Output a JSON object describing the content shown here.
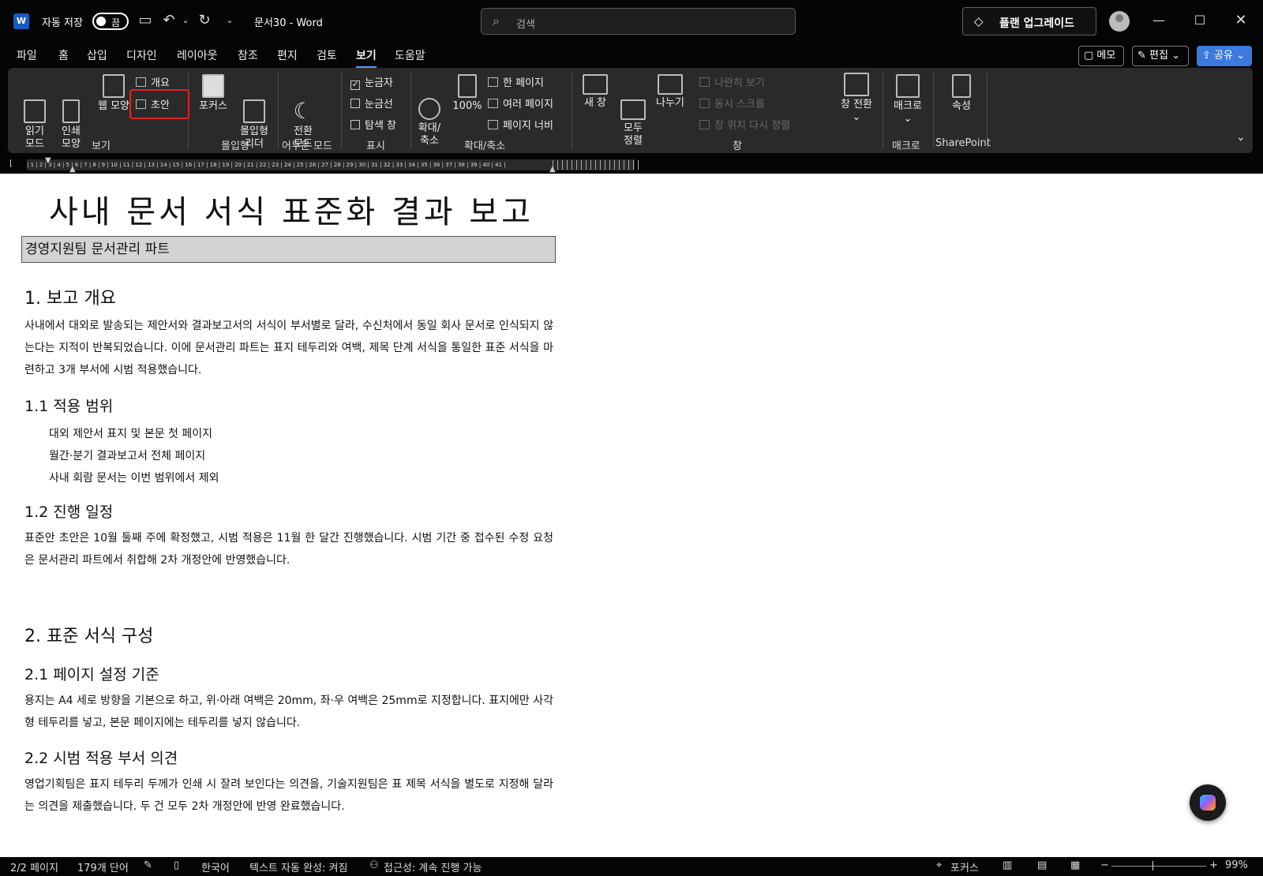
{
  "titlebar": {
    "app_logo": "W",
    "autosave_label": "자동 저장",
    "autosave_state": "끔",
    "document_title": "문서30  -  Word",
    "search_placeholder": "검색",
    "upgrade_label": "플랜 업그레이드"
  },
  "menu": {
    "items": [
      "파일",
      "홈",
      "삽입",
      "디자인",
      "레이아웃",
      "참조",
      "편지",
      "검토",
      "보기",
      "도움말"
    ],
    "active": "보기",
    "memo_label": "메모",
    "edit_label": "편집",
    "share_label": "공유"
  },
  "ribbon": {
    "views": {
      "read_mode": "읽기\n모드",
      "print_layout": "인쇄\n모양",
      "web_layout": "웹 모양",
      "outline": "개요",
      "draft": "초안",
      "group_label": "보기"
    },
    "immersive": {
      "focus": "포커스",
      "immersive_reader": "몰입형\n리더",
      "group_label": "몰입형"
    },
    "dark_mode": {
      "switch_mode": "전환\n모드",
      "group_label": "어두운 모드"
    },
    "show": {
      "ruler": "눈금자",
      "gridlines": "눈금선",
      "navigation_pane": "탐색 창",
      "group_label": "표시"
    },
    "zoom": {
      "zoom": "확대/\n축소",
      "hundred": "100%",
      "one_page": "한 페이지",
      "multiple_pages": "여러 페이지",
      "page_width": "페이지 너비",
      "group_label": "확대/축소"
    },
    "window": {
      "new_window": "새 창",
      "arrange_all": "모두\n정렬",
      "split": "나누기",
      "side_by_side": "나란히 보기",
      "sync_scroll": "동시 스크롤",
      "reset_position": "창 위치 다시 정렬",
      "switch_windows": "창 전환",
      "group_label": "창"
    },
    "macros": {
      "macros": "매크로",
      "group_label": "매크로"
    },
    "sharepoint": {
      "properties": "속성",
      "group_label": "SharePoint"
    }
  },
  "document": {
    "title": "사내 문서 서식 표준화 결과 보고",
    "subtitle": "경영지원팀 문서관리 파트",
    "s1_heading": "1. 보고 개요",
    "s1_para": "사내에서 대외로 발송되는 제안서와 결과보고서의 서식이 부서별로 달라, 수신처에서 동일 회사 문서로 인식되지 않는다는 지적이 반복되었습니다. 이에 문서관리 파트는 표지 테두리와 여백, 제목 단계 서식을 통일한 표준 서식을 마련하고 3개 부서에 시범 적용했습니다.",
    "s1_1_heading": "1.1  적용 범위",
    "s1_1_items": [
      "대외 제안서 표지 및 본문 첫 페이지",
      "월간·분기 결과보고서 전체 페이지",
      "사내 회람 문서는 이번 범위에서 제외"
    ],
    "s1_2_heading": "1.2  진행 일정",
    "s1_2_para": "표준안 초안은 10월 둘째 주에 확정했고, 시범 적용은 11월 한 달간 진행했습니다. 시범 기간 중 접수된 수정 요청은 문서관리 파트에서 취합해 2차 개정안에 반영했습니다.",
    "s2_heading": "2. 표준 서식 구성",
    "s2_1_heading": "2.1  페이지 설정 기준",
    "s2_1_para": "용지는 A4 세로 방향을 기본으로 하고, 위·아래 여백은 20mm, 좌·우 여백은 25mm로 지정합니다. 표지에만 사각형 테두리를 넣고, 본문 페이지에는 테두리를 넣지 않습니다.",
    "s2_2_heading": "2.2  시범 적용 부서 의견",
    "s2_2_para": "영업기획팀은 표지 테두리 두께가 인쇄 시 잘려 보인다는 의견을, 기술지원팀은 표 제목 서식을 별도로 지정해 달라는 의견을 제출했습니다. 두 건 모두 2차 개정안에 반영 완료했습니다."
  },
  "ruler": {
    "numbers": "| 1 | 2 | 3 | 4 | 5 | 6 | 7 | 8 | 9 | 10 | 11 | 12 | 13 | 14 | 15 | 16 | 17 | 18 | 19 | 20 | 21 | 22 | 23 | 24 | 25 | 26 | 27 | 28 | 29 | 30 | 31 | 32 | 33 | 34 | 35 | 36 | 37 | 38 | 39 | 40 | 41 |"
  },
  "statusbar": {
    "page": "2/2 페이지",
    "words": "179개 단어",
    "language": "한국어",
    "autocomplete": "텍스트 자동 완성: 켜짐",
    "accessibility": "접근성: 계속 진행 가능",
    "focus": "포커스",
    "zoom": "99%"
  },
  "colors": {
    "accent": "#4fa1ff",
    "share_button": "#3c7ae0",
    "highlight": "#e02424"
  }
}
